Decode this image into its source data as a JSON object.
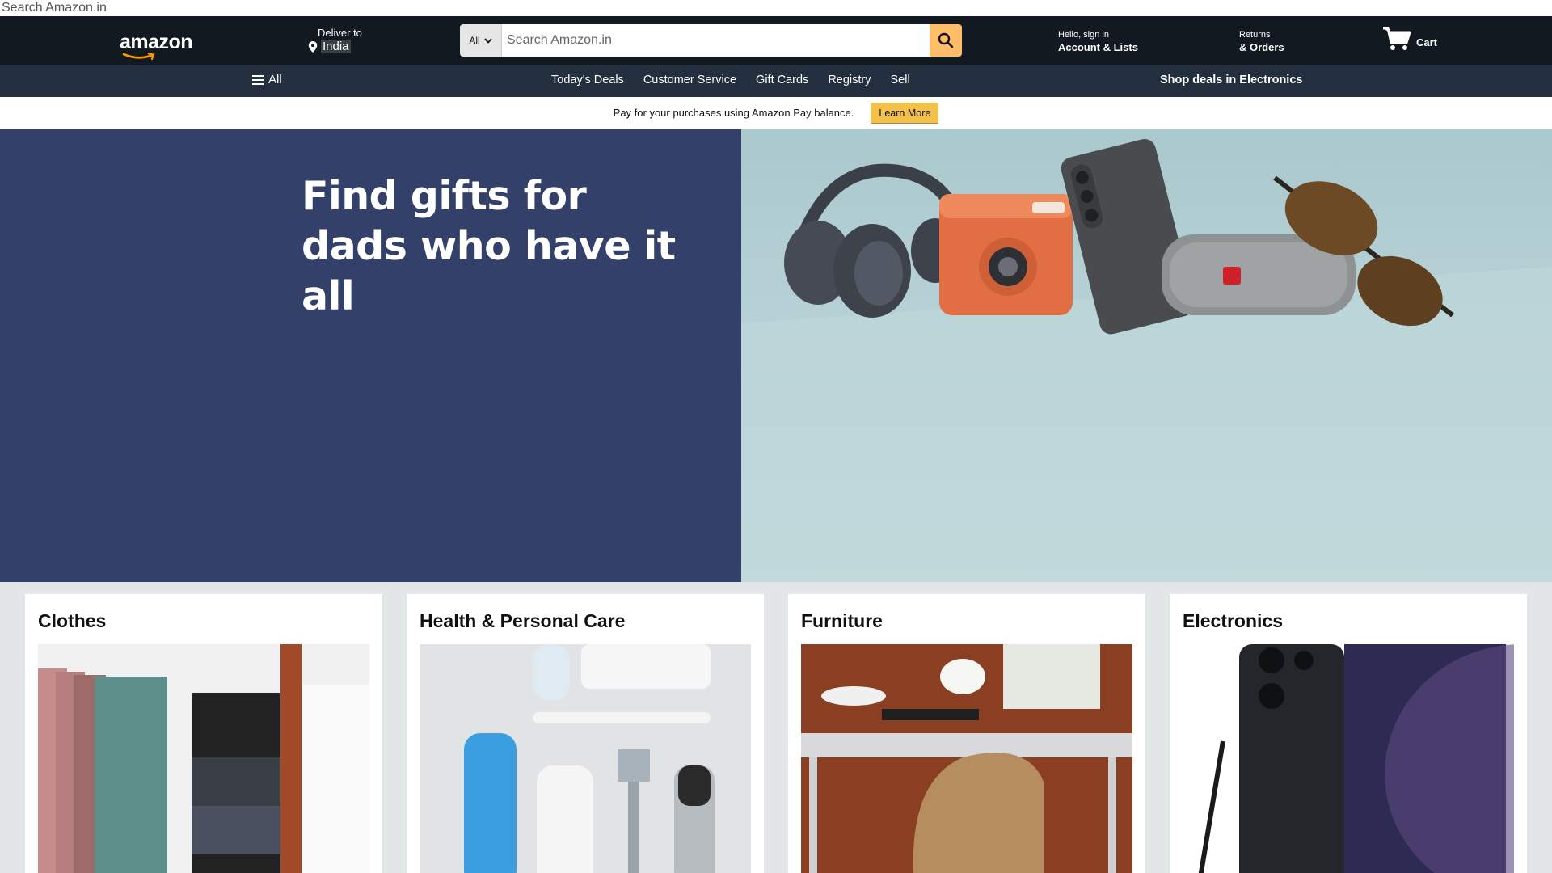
{
  "top_strip": {
    "text": "Search Amazon.in"
  },
  "header": {
    "logo_text": "amazon",
    "deliver_label": "Deliver to",
    "deliver_country": "India",
    "search": {
      "category": "All",
      "placeholder": "Search Amazon.in"
    },
    "account": {
      "greeting": "Hello, sign in",
      "label": "Account & Lists"
    },
    "returns": {
      "line1": "Returns",
      "line2": "& Orders"
    },
    "cart": {
      "label": "Cart"
    }
  },
  "subnav": {
    "all_label": "All",
    "links": [
      "Today's Deals",
      "Customer Service",
      "Gift Cards",
      "Registry",
      "Sell"
    ],
    "promo": "Shop deals in Electronics"
  },
  "pay_banner": {
    "text": "Pay for your purchases using Amazon Pay balance.",
    "button": "Learn More"
  },
  "hero": {
    "title_line1": "Find gifts for",
    "title_line2": "dads who have it all"
  },
  "cards": [
    {
      "title": "Clothes"
    },
    {
      "title": "Health & Personal Care"
    },
    {
      "title": "Furniture"
    },
    {
      "title": "Electronics"
    }
  ],
  "colors": {
    "nav_belt": "#131921",
    "nav_main": "#232f3e",
    "search_button": "#febd69",
    "hero_left": "#33406a",
    "learn_more": "#f3c14a"
  }
}
